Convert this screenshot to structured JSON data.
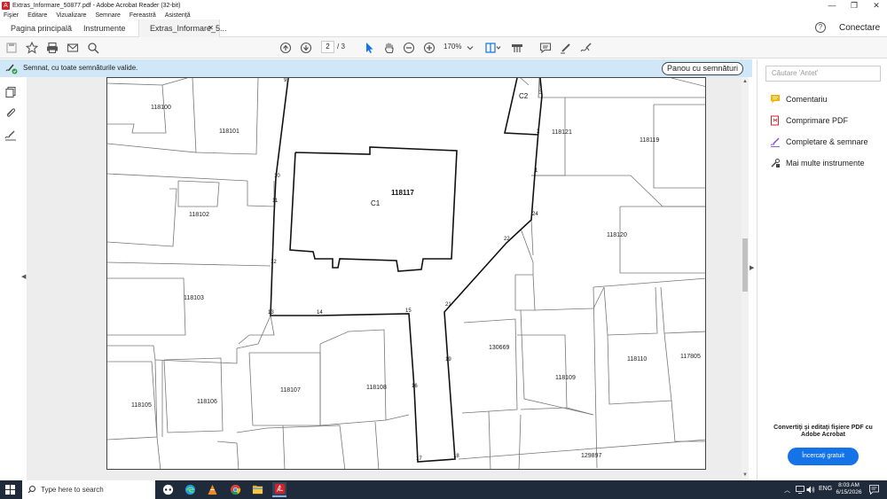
{
  "window": {
    "title": "Extras_Informare_50877.pdf - Adobe Acrobat Reader (32-bit)",
    "minimize": "—",
    "maximize": "❐",
    "close": "✕"
  },
  "menu": [
    "Fişier",
    "Editare",
    "Vizualizare",
    "Semnare",
    "Fereastră",
    "Asistenţă"
  ],
  "tabs": {
    "home": "Pagina principală",
    "tools": "Instrumente",
    "document": "Extras_Informare_5...",
    "close": "✕"
  },
  "header": {
    "help": "?",
    "signin": "Conectare"
  },
  "toolbar": {
    "page_current": "2",
    "page_total": "/ 3",
    "zoom": "170%"
  },
  "signature_bar": {
    "text": "Semnat, cu toate semnăturile valide.",
    "panel_button": "Panou cu semnături"
  },
  "document": {
    "parcels": [
      "118100",
      "118101",
      "118102",
      "118103",
      "118105",
      "118106",
      "118107",
      "118108",
      "118117",
      "118121",
      "118119",
      "118120",
      "130669",
      "118109",
      "118110",
      "117805",
      "129897"
    ],
    "buildings": [
      "C1",
      "C2"
    ],
    "points": [
      "9",
      "10",
      "11",
      "12",
      "13",
      "14",
      "15",
      "16",
      "17",
      "18",
      "19",
      "21",
      "22",
      "24",
      "1",
      "2",
      "3"
    ]
  },
  "right_panel": {
    "search_placeholder": "Căutare 'Antet'",
    "items": [
      "Comentariu",
      "Comprimare PDF",
      "Completare & semnare",
      "Mai multe instrumente"
    ],
    "promo": "Convertiţi şi editaţi fişiere PDF cu Adobe Acrobat",
    "trial": "Încercaţi gratuit"
  },
  "taskbar": {
    "search_placeholder": "Type here to search",
    "language": "ENG",
    "time": "8:03 AM",
    "date": "6/15/2026"
  },
  "colors": {
    "acrobat_red": "#d2232a",
    "sig_bar": "#cfe7f6",
    "accent_blue": "#1473e6",
    "taskbar": "#1f2b3a"
  }
}
